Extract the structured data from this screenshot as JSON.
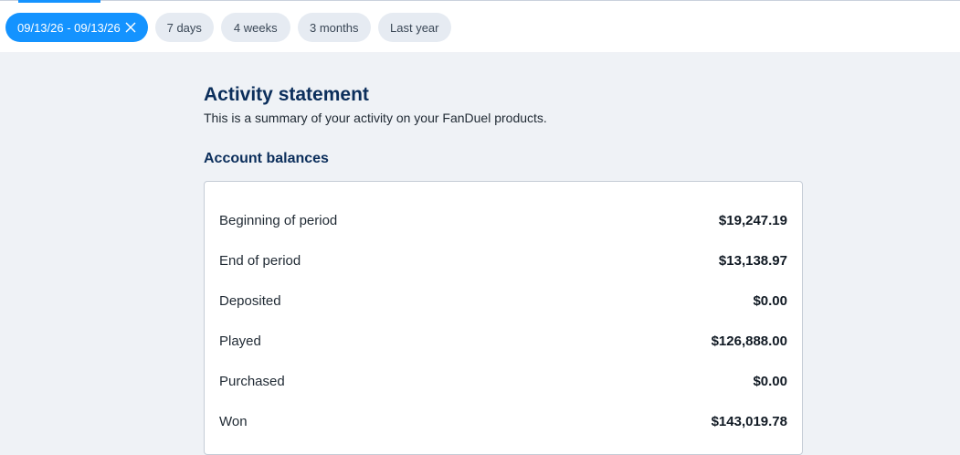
{
  "filters": {
    "active": {
      "label": "09/13/26 - 09/13/26"
    },
    "options": [
      {
        "label": "7 days"
      },
      {
        "label": "4 weeks"
      },
      {
        "label": "3 months"
      },
      {
        "label": "Last year"
      }
    ]
  },
  "statement": {
    "title": "Activity statement",
    "subtitle": "This is a summary of your activity on your FanDuel products.",
    "section_title": "Account balances",
    "rows": [
      {
        "label": "Beginning of period",
        "value": "$19,247.19"
      },
      {
        "label": "End of period",
        "value": "$13,138.97"
      },
      {
        "label": "Deposited",
        "value": "$0.00"
      },
      {
        "label": "Played",
        "value": "$126,888.00"
      },
      {
        "label": "Purchased",
        "value": "$0.00"
      },
      {
        "label": "Won",
        "value": "$143,019.78"
      }
    ]
  },
  "colors": {
    "accent": "#1493ff",
    "heading": "#0b2e5b",
    "background": "#eff2f6"
  },
  "icons": {
    "clear_filter": "close-icon"
  }
}
